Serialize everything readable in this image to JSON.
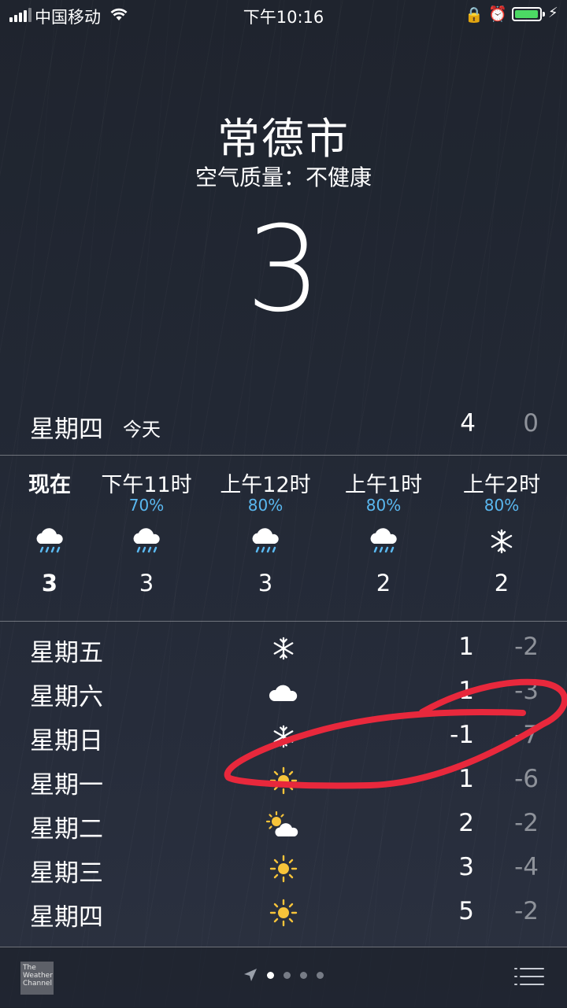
{
  "status_bar": {
    "carrier": "中国移动",
    "time": "下午10:16"
  },
  "header": {
    "city": "常德市",
    "air_quality": "空气质量：不健康",
    "current_temp": "3"
  },
  "today": {
    "day": "星期四",
    "label": "今天",
    "high": "4",
    "low": "0"
  },
  "hourly": [
    {
      "time": "现在",
      "precip": "",
      "icon": "rain-cloud-icon",
      "temp": "3"
    },
    {
      "time": "下午11时",
      "precip": "70%",
      "icon": "rain-cloud-icon",
      "temp": "3"
    },
    {
      "time": "上午12时",
      "precip": "80%",
      "icon": "rain-cloud-icon",
      "temp": "3"
    },
    {
      "time": "上午1时",
      "precip": "80%",
      "icon": "rain-cloud-icon",
      "temp": "2"
    },
    {
      "time": "上午2时",
      "precip": "80%",
      "icon": "snowflake-icon",
      "temp": "2"
    }
  ],
  "daily": [
    {
      "day": "星期五",
      "icon": "snowflake-icon",
      "high": "1",
      "low": "-2"
    },
    {
      "day": "星期六",
      "icon": "cloud-icon",
      "high": "1",
      "low": "-3"
    },
    {
      "day": "星期日",
      "icon": "snowflake-icon",
      "high": "-1",
      "low": "-7"
    },
    {
      "day": "星期一",
      "icon": "sun-icon",
      "high": "1",
      "low": "-6"
    },
    {
      "day": "星期二",
      "icon": "partly-cloudy-icon",
      "high": "2",
      "low": "-2"
    },
    {
      "day": "星期三",
      "icon": "sun-icon",
      "high": "3",
      "low": "-4"
    },
    {
      "day": "星期四",
      "icon": "sun-icon",
      "high": "5",
      "low": "-2"
    }
  ],
  "bottom": {
    "logo_text": "The Weather Channel",
    "pages": 4,
    "active_page": 1
  },
  "colors": {
    "precip_blue": "#5ab8f0",
    "sun_yellow": "#f7c43a",
    "annotation_red": "#e8283c",
    "battery_green": "#4cd964"
  }
}
